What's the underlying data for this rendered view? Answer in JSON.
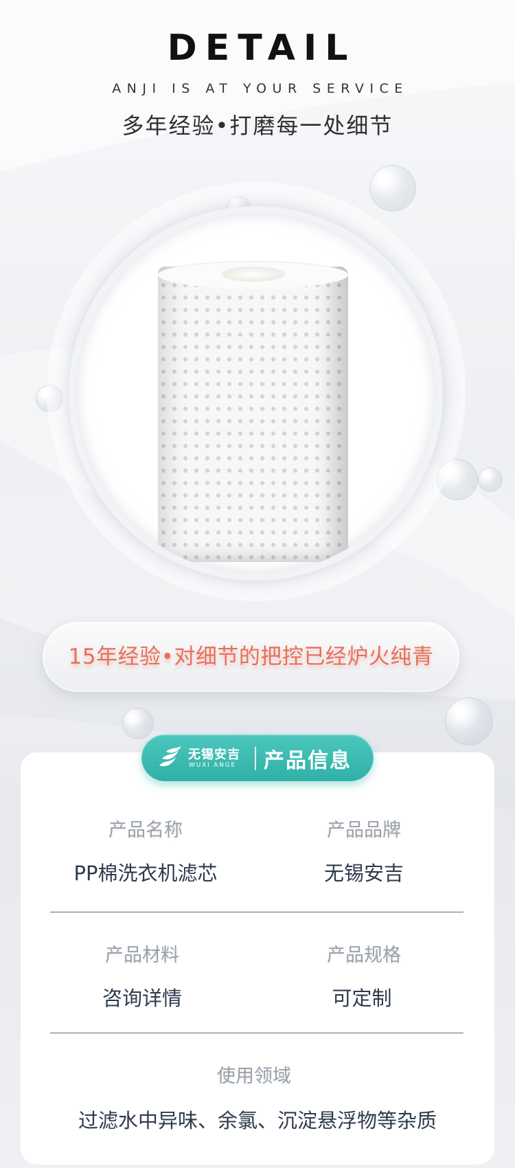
{
  "header": {
    "title": "DETAIL",
    "tagline": "ANJI IS AT YOUR SERVICE",
    "slogan": "多年经验•打磨每一处细节"
  },
  "highlight": {
    "text": "15年经验•对细节的把控已经炉火纯青"
  },
  "badge": {
    "brand_cn": "无锡安吉",
    "brand_en": "WUXI ANGE",
    "title": "产品信息"
  },
  "info": {
    "fields": [
      {
        "label": "产品名称",
        "value": "PP棉洗衣机滤芯"
      },
      {
        "label": "产品品牌",
        "value": "无锡安吉"
      },
      {
        "label": "产品材料",
        "value": "咨询详情"
      },
      {
        "label": "产品规格",
        "value": "可定制"
      },
      {
        "label": "使用领域",
        "value": "过滤水中异味、余氯、沉淀悬浮物等杂质"
      }
    ]
  },
  "colors": {
    "accent_teal": "#2fb0a6",
    "highlight_orange": "#e8705a",
    "value_text": "#2e3a4c",
    "label_text": "#9aa1ab"
  }
}
